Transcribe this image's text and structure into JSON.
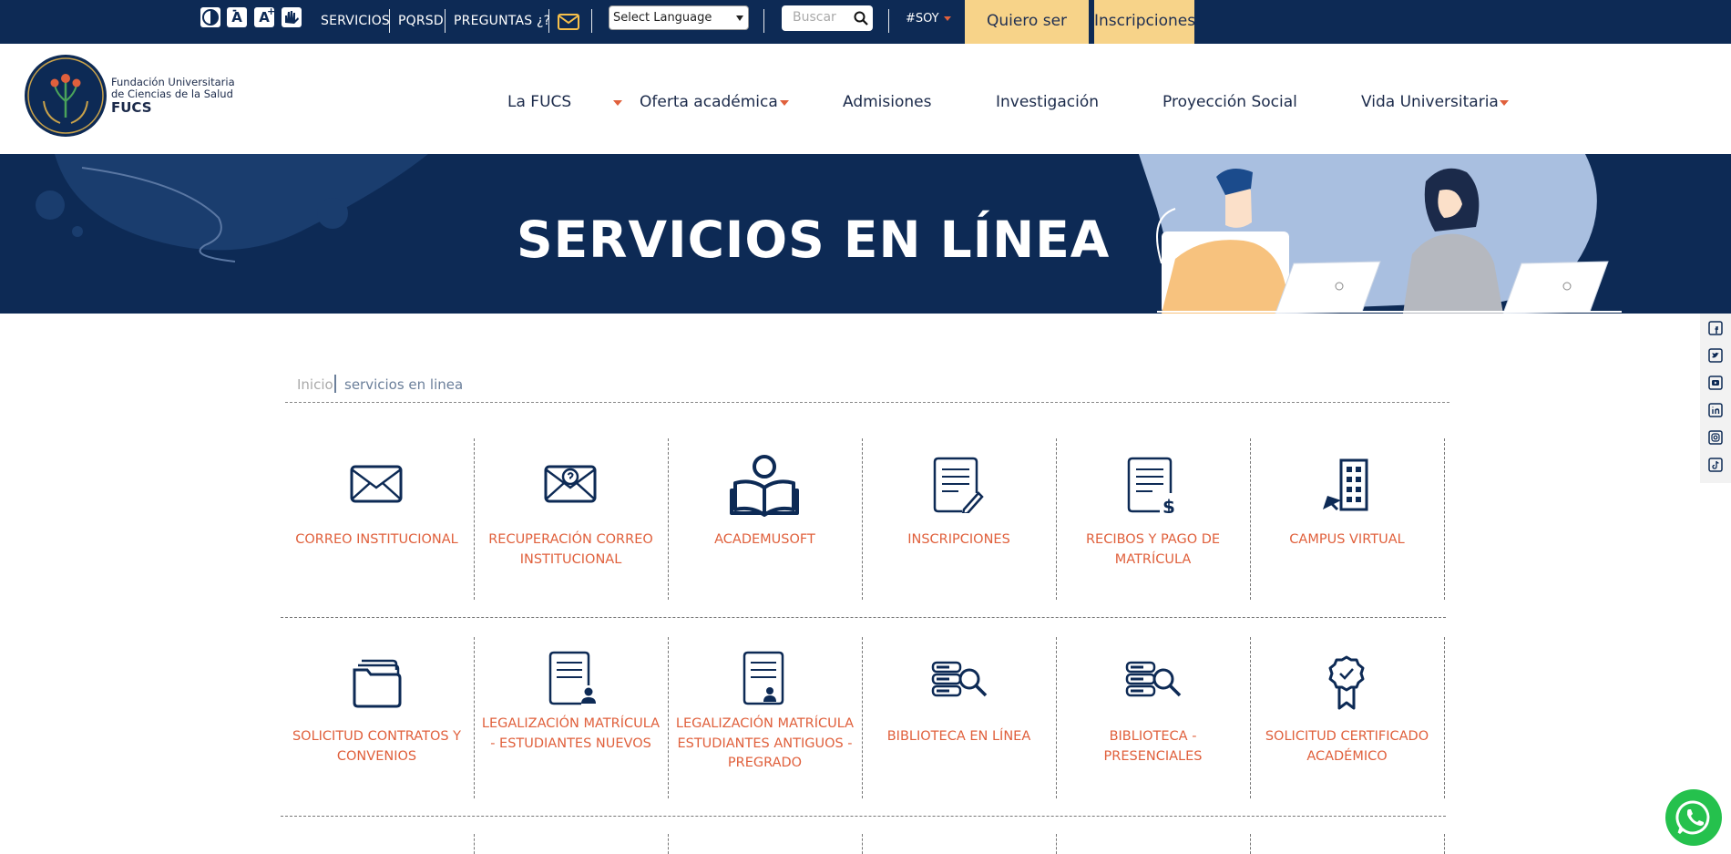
{
  "topbar": {
    "accessibility": [
      {
        "name": "contrast-icon",
        "glyph": ""
      },
      {
        "name": "font-decrease-icon",
        "glyph": "A"
      },
      {
        "name": "font-increase-icon",
        "glyph": "A"
      },
      {
        "name": "sign-language-icon",
        "glyph": ""
      }
    ],
    "links": {
      "servicios": "SERVICIOS",
      "pqrsd": "PQRSD",
      "preguntas": "PREGUNTAS ¿?"
    },
    "language": "Select Language",
    "search_placeholder": "Buscar",
    "soy": "#SOY",
    "quiero": "Quiero ser FUCS",
    "inscripciones": "Inscripciones"
  },
  "logo": {
    "line1": "Fundación Universitaria",
    "line2": "de Ciencias de la Salud",
    "line3": "FUCS"
  },
  "nav": {
    "la_fucs": "La FUCS",
    "oferta": "Oferta académica",
    "admisiones": "Admisiones",
    "investigacion": "Investigación",
    "proyeccion": "Proyección Social",
    "vida": "Vida Universitaria"
  },
  "banner": {
    "title": "SERVICIOS EN LÍNEA"
  },
  "breadcrumb": {
    "home": "Inicio",
    "current": "servicios en linea"
  },
  "services_row1": [
    {
      "label": "CORREO INSTITUCIONAL",
      "icon": "envelope-icon"
    },
    {
      "label": "RECUPERACIÓN CORREO INSTITUCIONAL",
      "icon": "envelope-recovery-icon"
    },
    {
      "label": "ACADEMUSOFT",
      "icon": "reader-icon"
    },
    {
      "label": "INSCRIPCIONES",
      "icon": "document-edit-icon"
    },
    {
      "label": "RECIBOS Y PAGO DE MATRÍCULA",
      "icon": "document-payment-icon"
    },
    {
      "label": "CAMPUS VIRTUAL",
      "icon": "building-icon"
    }
  ],
  "services_row2": [
    {
      "label": "SOLICITUD CONTRATOS Y CONVENIOS",
      "icon": "folder-icon"
    },
    {
      "label": "LEGALIZACIÓN MATRÍCULA - ESTUDIANTES NUEVOS",
      "icon": "document-user-icon"
    },
    {
      "label": "LEGALIZACIÓN MATRÍCULA ESTUDIANTES ANTIGUOS - PREGRADO",
      "icon": "document-user-icon"
    },
    {
      "label": "BIBLIOTECA EN LÍNEA",
      "icon": "database-search-icon"
    },
    {
      "label": "BIBLIOTECA - PRESENCIALES",
      "icon": "database-search-icon"
    },
    {
      "label": "SOLICITUD CERTIFICADO ACADÉMICO",
      "icon": "certificate-icon"
    }
  ],
  "social": [
    "facebook-icon",
    "twitter-icon",
    "youtube-icon",
    "linkedin-icon",
    "instagram-icon",
    "tiktok-icon"
  ],
  "colors": {
    "navy": "#0d2a55",
    "accent": "#e0603c",
    "yellow": "#f7d389",
    "whatsapp": "#25c14d"
  }
}
